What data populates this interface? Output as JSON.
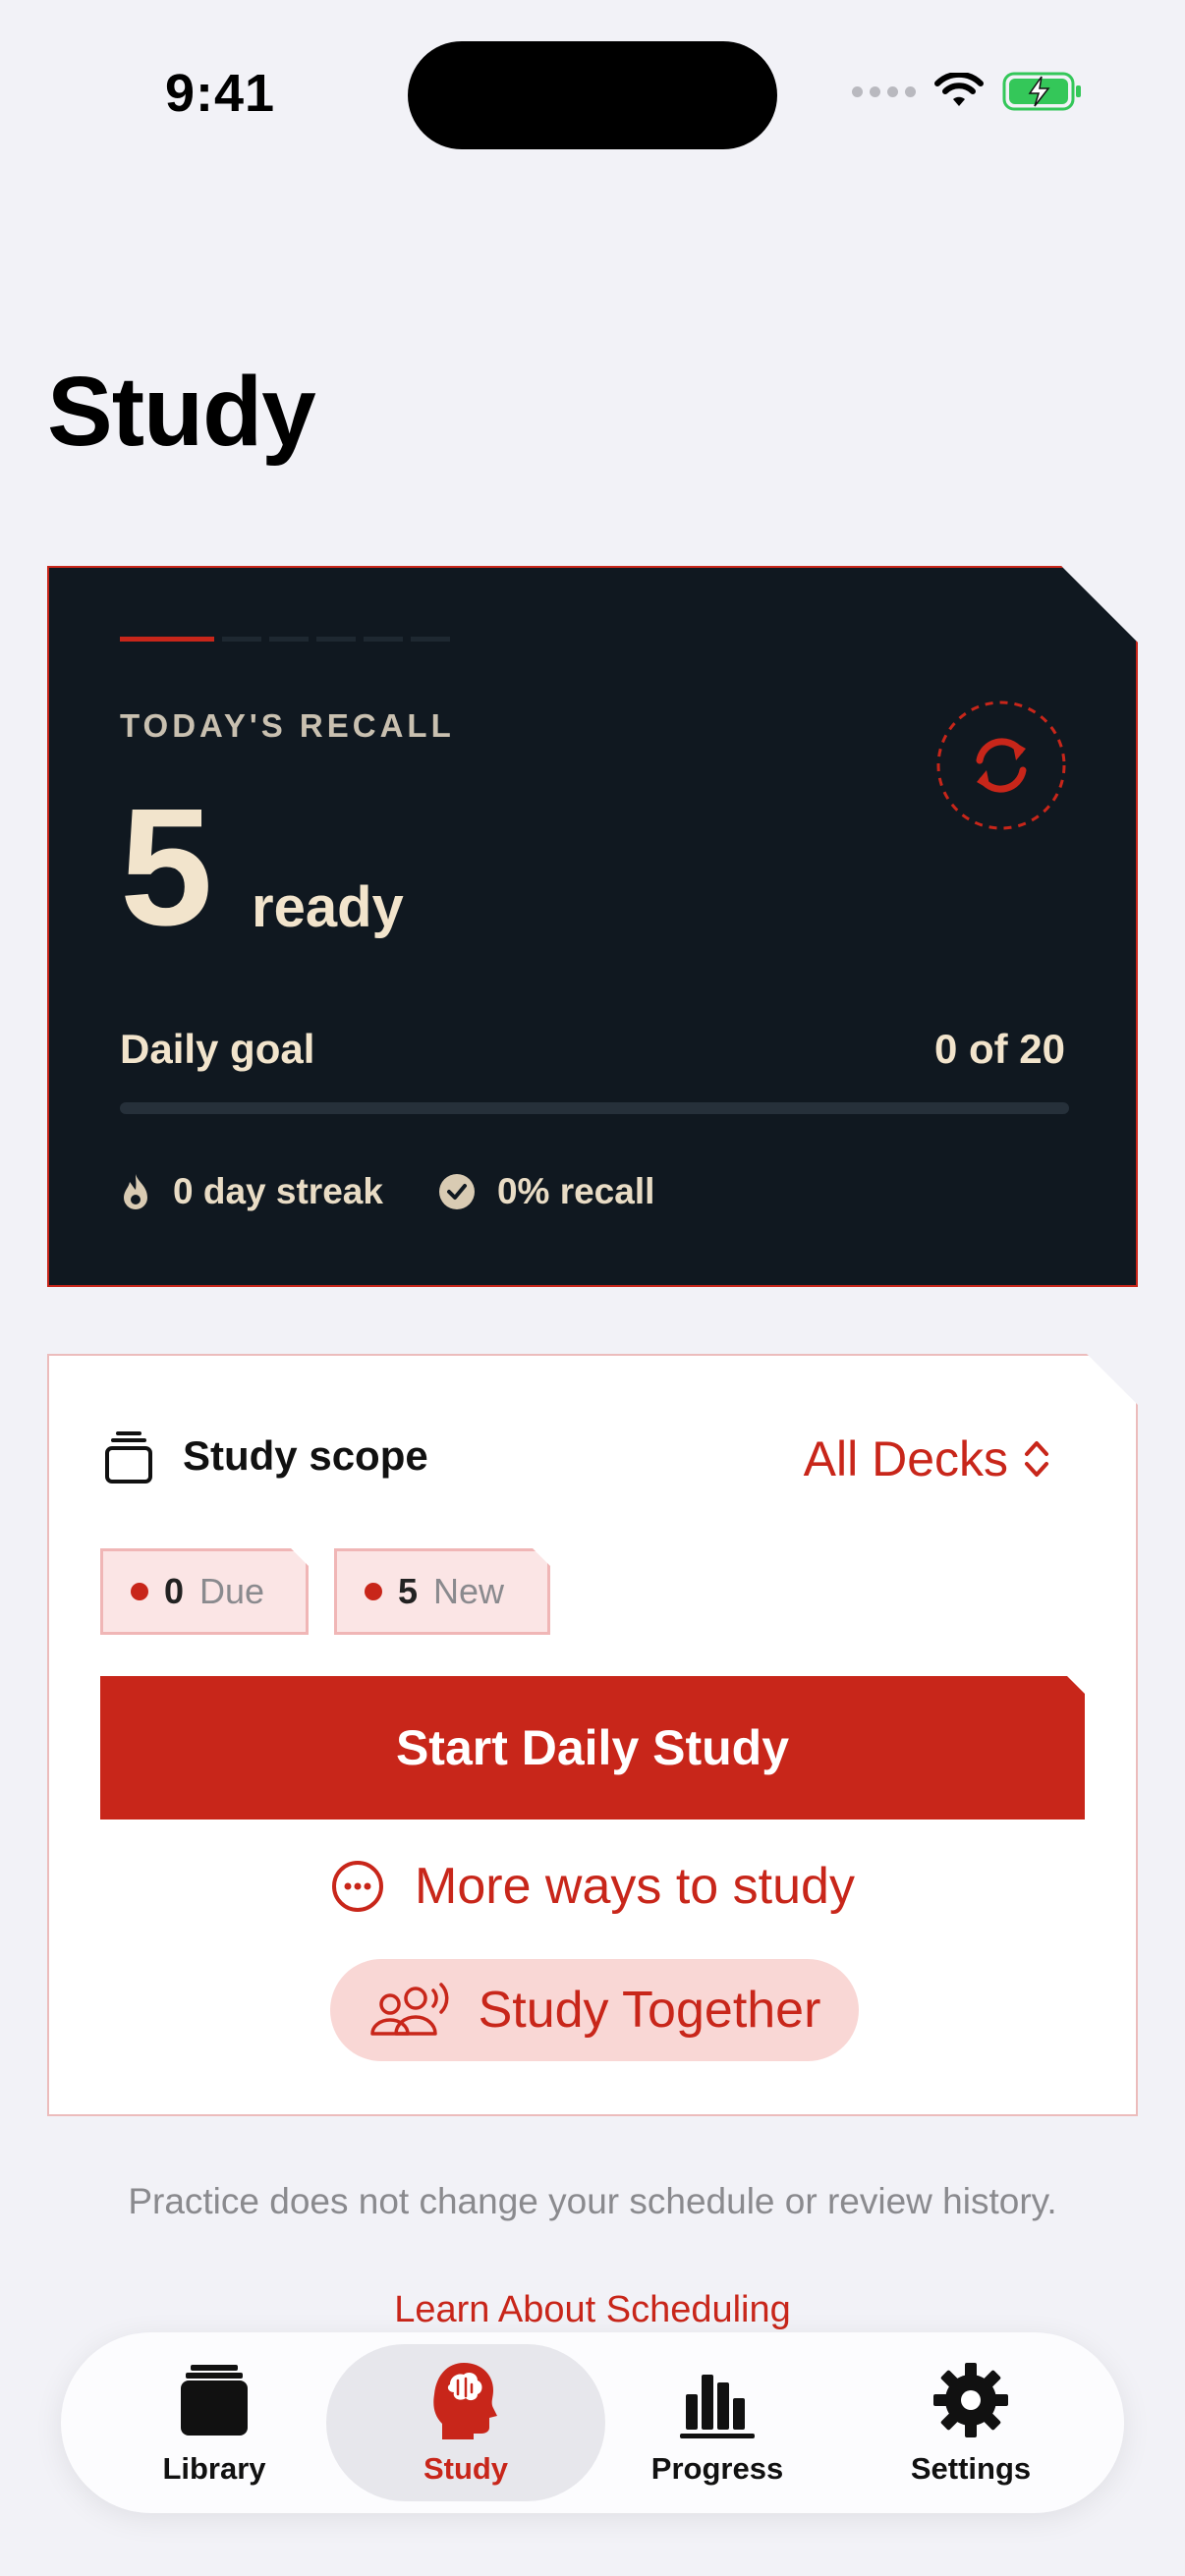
{
  "status_bar": {
    "time": "9:41"
  },
  "page": {
    "title": "Study"
  },
  "recall_card": {
    "label": "TODAY'S RECALL",
    "count": "5",
    "unit": "ready",
    "goal_label": "Daily goal",
    "goal_value": "0 of 20",
    "goal_progress": 0,
    "streak": "0 day streak",
    "recall": "0% recall",
    "accent_color": "#c8261a"
  },
  "scope_card": {
    "label": "Study scope",
    "deck_selected": "All Decks",
    "due_count": "0",
    "due_label": "Due",
    "new_count": "5",
    "new_label": "New",
    "start_button": "Start Daily Study",
    "more_ways": "More ways to study",
    "study_together": "Study Together"
  },
  "footer": {
    "note": "Practice does not change your schedule or review history.",
    "learn_link": "Learn About Scheduling"
  },
  "tab_bar": {
    "items": [
      {
        "label": "Library",
        "icon": "library-icon"
      },
      {
        "label": "Study",
        "icon": "brain-head-icon",
        "active": true
      },
      {
        "label": "Progress",
        "icon": "bar-chart-icon"
      },
      {
        "label": "Settings",
        "icon": "gear-icon"
      }
    ]
  }
}
